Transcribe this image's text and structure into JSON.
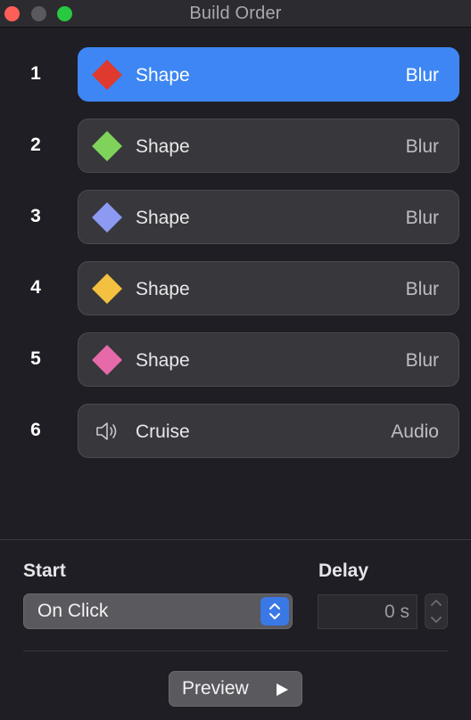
{
  "window": {
    "title": "Build Order"
  },
  "builds": [
    {
      "number": "1",
      "name": "Shape",
      "effect": "Blur",
      "color": "#e0392d",
      "icon": "diamond-shape-icon",
      "selected": true
    },
    {
      "number": "2",
      "name": "Shape",
      "effect": "Blur",
      "color": "#7fd35a",
      "icon": "diamond-shape-icon",
      "selected": false
    },
    {
      "number": "3",
      "name": "Shape",
      "effect": "Blur",
      "color": "#8c9af2",
      "icon": "diamond-shape-icon",
      "selected": false
    },
    {
      "number": "4",
      "name": "Shape",
      "effect": "Blur",
      "color": "#f3c03f",
      "icon": "diamond-shape-icon",
      "selected": false
    },
    {
      "number": "5",
      "name": "Shape",
      "effect": "Blur",
      "color": "#e66aaa",
      "icon": "diamond-shape-icon",
      "selected": false
    },
    {
      "number": "6",
      "name": "Cruise",
      "effect": "Audio",
      "icon": "speaker-icon",
      "selected": false
    }
  ],
  "controls": {
    "start_label": "Start",
    "start_value": "On Click",
    "delay_label": "Delay",
    "delay_value": "0 s",
    "preview_label": "Preview"
  },
  "colors": {
    "accent": "#3d86f4",
    "background": "#1f1e24",
    "row": "#38373c"
  }
}
